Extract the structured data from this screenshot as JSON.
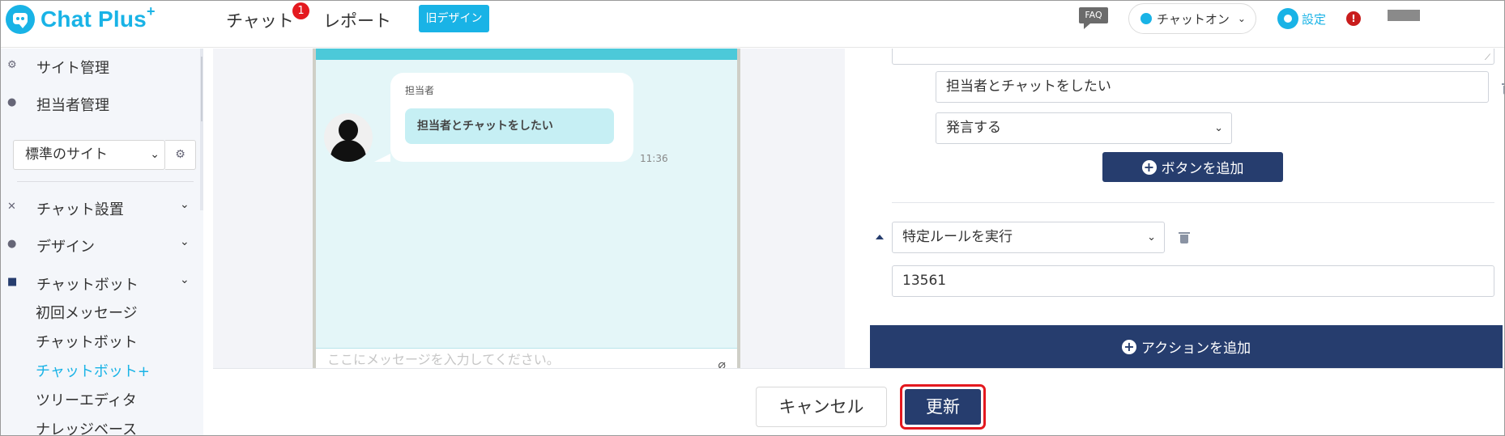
{
  "header": {
    "logo_text": "Chat Plus",
    "logo_sup": "+",
    "nav": {
      "chat": "チャット",
      "chat_badge": "1",
      "report": "レポート"
    },
    "old_design": "旧デザイン",
    "faq": "FAQ",
    "chat_status": "チャットオン",
    "settings": "設定",
    "alert": "!"
  },
  "sidebar": {
    "site_admin": "サイト管理",
    "staff_admin": "担当者管理",
    "site_select": "標準のサイト",
    "chat_settings": "チャット設置",
    "design": "デザイン",
    "chatbot": "チャットボット",
    "sub_items": [
      "初回メッセージ",
      "チャットボット",
      "チャットボット+",
      "ツリーエディタ",
      "ナレッジベース"
    ]
  },
  "preview": {
    "sender": "担当者",
    "message": "担当者とチャットをしたい",
    "time": "11:36",
    "input_placeholder": "ここにメッセージを入力してください。"
  },
  "panel": {
    "button_text": "担当者とチャットをしたい",
    "button_action": "発言する",
    "add_button": "ボタンを追加",
    "rule_action": "特定ルールを実行",
    "rule_id": "13561",
    "add_action": "アクションを追加"
  },
  "footer": {
    "cancel": "キャンセル",
    "update": "更新"
  },
  "colors": {
    "brand": "#19b3e6",
    "navy": "#263d6e",
    "alert": "#e4191f"
  }
}
